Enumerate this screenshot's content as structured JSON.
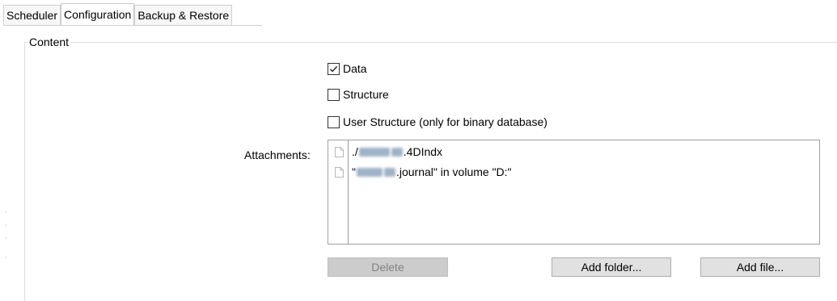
{
  "tabs": [
    {
      "label": "Scheduler",
      "active": false
    },
    {
      "label": "Configuration",
      "active": true
    },
    {
      "label": "Backup & Restore",
      "active": false
    }
  ],
  "content_group": {
    "legend": "Content",
    "checkboxes": [
      {
        "label": "Data",
        "checked": true
      },
      {
        "label": "Structure",
        "checked": false
      },
      {
        "label": "User Structure (only for binary database)",
        "checked": false
      }
    ],
    "attachments": {
      "label": "Attachments:",
      "items": [
        {
          "prefix": "./",
          "suffix": ".4DIndx"
        },
        {
          "prefix": "\"",
          "suffix": ".journal\" in volume \"D:\""
        }
      ]
    },
    "buttons": {
      "delete": "Delete",
      "add_folder": "Add folder...",
      "add_file": "Add file..."
    }
  },
  "colors": {
    "disabled_button_bg": "#cccccc",
    "button_bg": "#e1e1e1",
    "blurred_text": "#9fb3c8"
  }
}
